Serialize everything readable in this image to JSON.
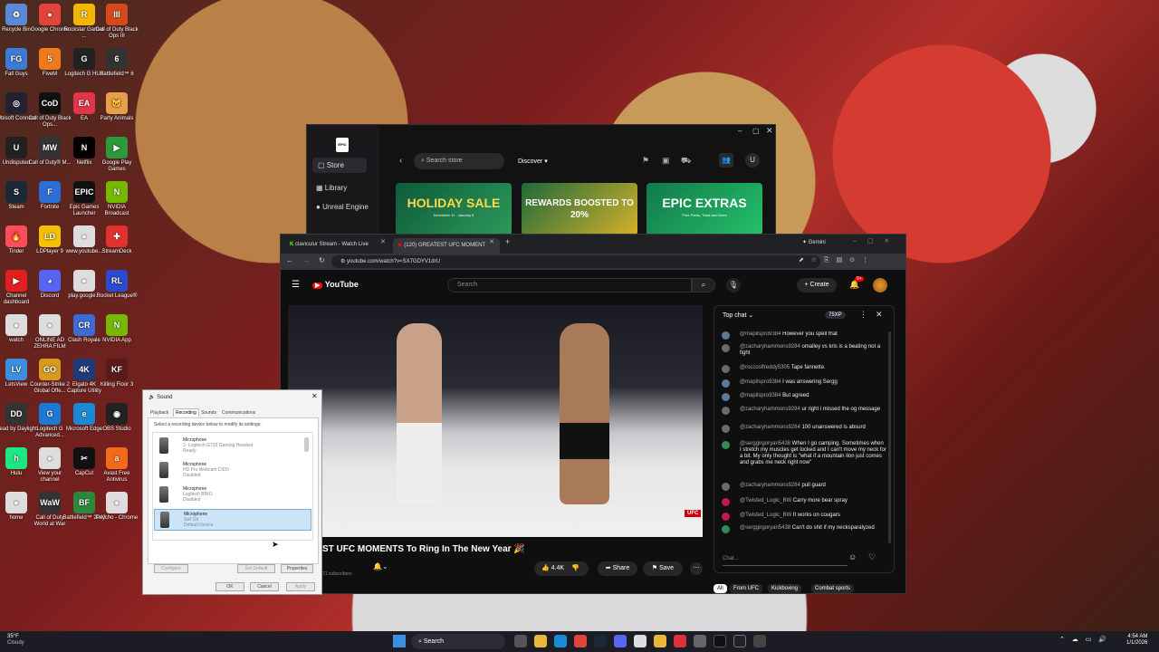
{
  "desktop_icons": [
    {
      "label": "Recycle Bin",
      "color": "#5a8ad6",
      "glyph": "♻"
    },
    {
      "label": "Google Chrome",
      "color": "#e0443a",
      "glyph": "●"
    },
    {
      "label": "Rockstar Games ...",
      "color": "#f2b705",
      "glyph": "R"
    },
    {
      "label": "Call of Duty Black Ops III",
      "color": "#d44a1a",
      "glyph": "III"
    },
    {
      "label": "Fall Guys",
      "color": "#3b7bd6",
      "glyph": "FG"
    },
    {
      "label": "FiveM",
      "color": "#f07a1a",
      "glyph": "5"
    },
    {
      "label": "Logitech G HUB",
      "color": "#222",
      "glyph": "G"
    },
    {
      "label": "Battlefield™ 6",
      "color": "#333",
      "glyph": "6"
    },
    {
      "label": "Ubisoft Connect",
      "color": "#223",
      "glyph": "◎"
    },
    {
      "label": "Call of Duty Black Ops...",
      "color": "#111",
      "glyph": "CoD"
    },
    {
      "label": "EA",
      "color": "#e2344a",
      "glyph": "EA"
    },
    {
      "label": "Party Animals",
      "color": "#e7a04a",
      "glyph": "🐱"
    },
    {
      "label": "Undisputed",
      "color": "#222",
      "glyph": "U"
    },
    {
      "label": "Call of Duty® M...",
      "color": "#333",
      "glyph": "MW"
    },
    {
      "label": "Netflix",
      "color": "#000",
      "glyph": "N"
    },
    {
      "label": "Google Play Games",
      "color": "#2a9a3a",
      "glyph": "▶"
    },
    {
      "label": "Steam",
      "color": "#1b2838",
      "glyph": "S"
    },
    {
      "label": "Fortnite",
      "color": "#2b6fd6",
      "glyph": "F"
    },
    {
      "label": "Epic Games Launcher",
      "color": "#111",
      "glyph": "EPIC"
    },
    {
      "label": "NVIDIA Broadcast",
      "color": "#76b900",
      "glyph": "N"
    },
    {
      "label": "Tinder",
      "color": "#fd4d5c",
      "glyph": "🔥"
    },
    {
      "label": "LDPlayer 9",
      "color": "#f2c200",
      "glyph": "LD"
    },
    {
      "label": "www.youtube...",
      "color": "#ddd",
      "glyph": "●"
    },
    {
      "label": "StreamDeck",
      "color": "#e3322e",
      "glyph": "✚"
    },
    {
      "label": "Channel dashboard",
      "color": "#e02020",
      "glyph": "▶"
    },
    {
      "label": "Discord",
      "color": "#5865f2",
      "glyph": "◕"
    },
    {
      "label": "play.google...",
      "color": "#ddd",
      "glyph": "●"
    },
    {
      "label": "Rocket League®",
      "color": "#2a4bd0",
      "glyph": "RL"
    },
    {
      "label": "watch",
      "color": "#ddd",
      "glyph": "●"
    },
    {
      "label": "ONLINE AD ZEHRA FILM",
      "color": "#ddd",
      "glyph": "●"
    },
    {
      "label": "Clash Royale",
      "color": "#3b6cd6",
      "glyph": "CR"
    },
    {
      "label": "NVIDIA App",
      "color": "#76b900",
      "glyph": "N"
    },
    {
      "label": "LetsView",
      "color": "#3b8fe0",
      "glyph": "LV"
    },
    {
      "label": "Counter-Strike 2 Global Offe...",
      "color": "#d79a1a",
      "glyph": "GO"
    },
    {
      "label": "Elgato 4K Capture Utility",
      "color": "#1d3a7a",
      "glyph": "4K"
    },
    {
      "label": "Killing Floor 3",
      "color": "#5a1a1a",
      "glyph": "KF"
    },
    {
      "label": "Dead by Daylight",
      "color": "#333",
      "glyph": "DD"
    },
    {
      "label": "Logitech G Advanced...",
      "color": "#1a7ad6",
      "glyph": "G"
    },
    {
      "label": "Microsoft Edge",
      "color": "#1a8ad6",
      "glyph": "e"
    },
    {
      "label": "OBS Studio",
      "color": "#222",
      "glyph": "◉"
    },
    {
      "label": "Hulu",
      "color": "#1ce783",
      "glyph": "h"
    },
    {
      "label": "View your channel",
      "color": "#ddd",
      "glyph": "●"
    },
    {
      "label": "CapCut",
      "color": "#111",
      "glyph": "✂"
    },
    {
      "label": "Avast Free Antivirus",
      "color": "#f26a1a",
      "glyph": "a"
    },
    {
      "label": "home",
      "color": "#ddd",
      "glyph": "●"
    },
    {
      "label": "Call of Duty World at War",
      "color": "#333",
      "glyph": "WaW"
    },
    {
      "label": "Battlefield™ 2042",
      "color": "#2a8a3a",
      "glyph": "BF"
    },
    {
      "label": "Psycho - Chrome",
      "color": "#ddd",
      "glyph": "●"
    }
  ],
  "epic": {
    "logo": "EPIC",
    "nav": [
      "Store",
      "Library",
      "Unreal Engine"
    ],
    "search_placeholder": "Search store",
    "discover": "Discover",
    "avatar": "U",
    "banners": [
      {
        "text": "HOLIDAY SALE",
        "sub": "December 11 - January 8",
        "color": "#1f6f4a"
      },
      {
        "text": "REWARDS BOOSTED TO 20%",
        "sub": "",
        "color": "#cfae2a"
      },
      {
        "text": "EPIC EXTRAS",
        "sub": "Free Perks, Trials and More",
        "color": "#1a8a55"
      }
    ]
  },
  "chrome": {
    "tabs": [
      {
        "label": "claviculur Stream - Watch Live"
      },
      {
        "label": "(120) GREATEST UFC MOMENT"
      }
    ],
    "gemini": "Gemini",
    "url": "youtube.com/watch?v=SX7GDYV1drU",
    "yt": {
      "logo": "YouTube",
      "search_placeholder": "Search",
      "create": "Create",
      "notif_count": "9+",
      "video_title": "ST UFC MOMENTS To Ring In The New Year 🎉",
      "subscribers": "71 subscribers",
      "likes": "4.4K",
      "share": "Share",
      "save": "Save",
      "filters": [
        "All",
        "From UFC",
        "Kickboxing",
        "Combat sports"
      ]
    },
    "chat": {
      "header": "Top chat",
      "points": "75XP",
      "input_placeholder": "Chat...",
      "messages": [
        {
          "user": "@mapilspro9384",
          "text": "However you spell that",
          "color": "#5a7a9a"
        },
        {
          "user": "@zacharyhammons9284",
          "text": "omalley vs kris is a beating not a fight",
          "color": "#6a6a6a"
        },
        {
          "user": "@roccoslfreddy5305",
          "text": "Tape fannette.",
          "color": "#6a6a6a"
        },
        {
          "user": "@mapilspro9384",
          "text": "I was answering Sergg",
          "color": "#5a7a9a"
        },
        {
          "user": "@mapilspro9384",
          "text": "But agreed",
          "color": "#5a7a9a"
        },
        {
          "user": "@zacharyhammons9284",
          "text": "ur right i missed the og message",
          "color": "#6a6a6a"
        },
        {
          "user": "@zacharyhammons9284",
          "text": "100 unanswered is absurd",
          "color": "#6a6a6a"
        },
        {
          "user": "@serggirgoryan5438",
          "text": "When I go camping. Sometimes when I stretch my muscles get locked and I can't move my neck for a bit. My only thought is \"what if a mountain lion just comes and grabs me neck right now\"",
          "color": "#2e8b57"
        },
        {
          "user": "@zacharyhammons9284",
          "text": "pull guard",
          "color": "#6a6a6a"
        },
        {
          "user": "@Twisted_Logic_BW",
          "text": "Carry more bear spray",
          "color": "#c2185b"
        },
        {
          "user": "@Twisted_Logic_BW",
          "text": "It works on cougars",
          "color": "#c2185b"
        },
        {
          "user": "@serggirgoryan5438",
          "text": "Can't do shit if my necksparalyzed",
          "color": "#2e8b57"
        }
      ]
    }
  },
  "sound": {
    "title": "Sound",
    "tabs": [
      "Playback",
      "Recording",
      "Sounds",
      "Communications"
    ],
    "instruction": "Select a recording device below to modify its settings:",
    "devices": [
      {
        "name": "Microphone",
        "desc": "2- Logitech G733 Gaming Headset",
        "status": "Ready"
      },
      {
        "name": "Microphone",
        "desc": "HD Pro Webcam C920",
        "status": "Disabled"
      },
      {
        "name": "Microphone",
        "desc": "Logitech BRIO",
        "status": "Disabled"
      },
      {
        "name": "Microphone",
        "desc": "Sell Gil",
        "status": "Default Device"
      }
    ],
    "configure": "Configure",
    "set_default": "Set Default",
    "properties": "Properties",
    "ok": "OK",
    "cancel": "Cancel",
    "apply": "Apply"
  },
  "taskbar": {
    "weather_temp": "35°F",
    "weather_desc": "Cloudy",
    "search": "Search",
    "time": "4:54 AM",
    "date": "1/1/2026"
  }
}
